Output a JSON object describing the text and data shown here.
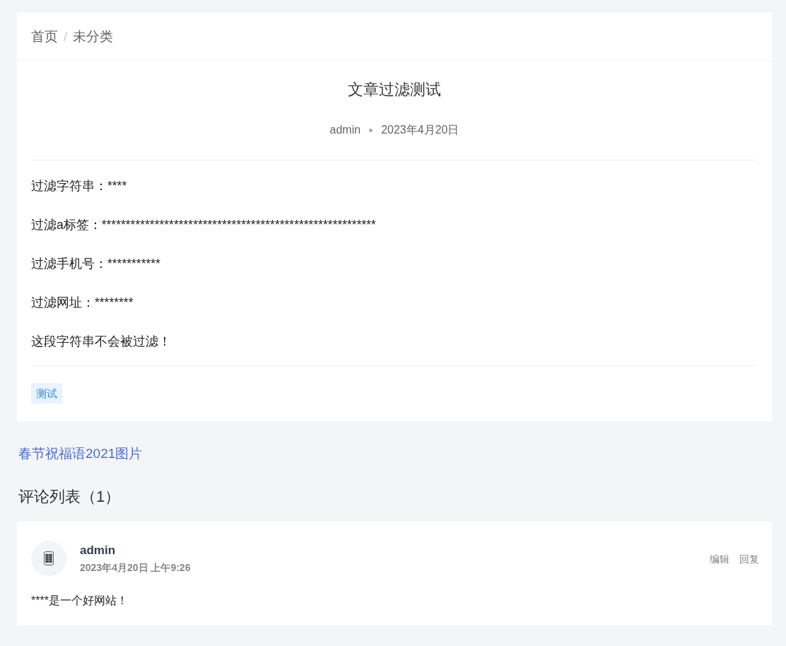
{
  "breadcrumb": {
    "items": [
      {
        "label": "首页"
      },
      {
        "label": "未分类"
      }
    ],
    "separator": "/"
  },
  "article": {
    "title": "文章过滤测试",
    "author": "admin",
    "date": "2023年4月20日",
    "paragraphs": [
      "过滤字符串：****",
      "过滤a标签：*********************************************************",
      "过滤手机号：***********",
      "过滤网址：********",
      "这段字符串不会被过滤！"
    ],
    "tags": [
      "测试"
    ]
  },
  "related_link": "春节祝福语2021图片",
  "comments": {
    "heading": "评论列表（1）",
    "items": [
      {
        "author": "admin",
        "time": "2023年4月20日 上午9:26",
        "text": "****是一个好网站！",
        "actions": [
          "编辑",
          "回复"
        ]
      }
    ]
  }
}
